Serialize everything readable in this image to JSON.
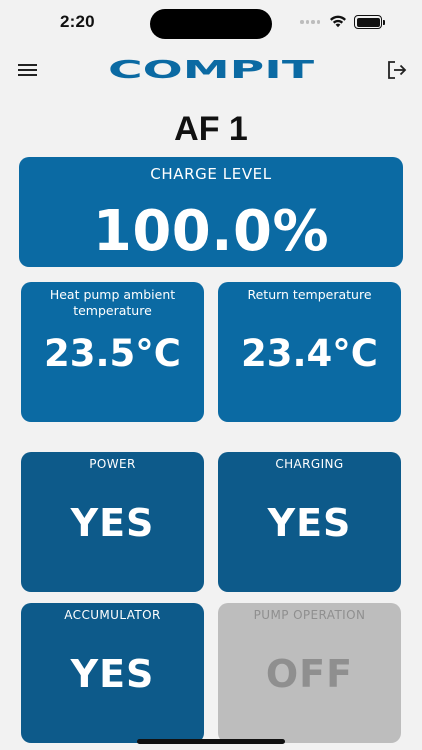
{
  "status_bar": {
    "time": "2:20",
    "icons": [
      "cellular-signal-icon",
      "wifi-icon",
      "battery-icon"
    ]
  },
  "header": {
    "logo_text": "COMPIT",
    "logo_color": "#0b6aa3",
    "menu_icon": "hamburger-menu-icon",
    "logout_icon": "logout-icon"
  },
  "device": {
    "name": "AF 1"
  },
  "tiles": {
    "charge_level": {
      "label": "CHARGE LEVEL",
      "value": "100.0%"
    },
    "ambient_temp": {
      "label": "Heat pump ambient temperature",
      "value": "23.5°C"
    },
    "return_temp": {
      "label": "Return temperature",
      "value": "23.4°C"
    },
    "power": {
      "label": "POWER",
      "value": "YES"
    },
    "charging": {
      "label": "CHARGING",
      "value": "YES"
    },
    "accumulator": {
      "label": "ACCUMULATOR",
      "value": "YES"
    },
    "pump_operation": {
      "label": "PUMP OPERATION",
      "value": "OFF"
    }
  },
  "colors": {
    "tile_blue": "#0b6aa3",
    "tile_dark_blue": "#0d5a8a",
    "tile_off": "#bdbdbd",
    "background": "#f2f2f2"
  }
}
